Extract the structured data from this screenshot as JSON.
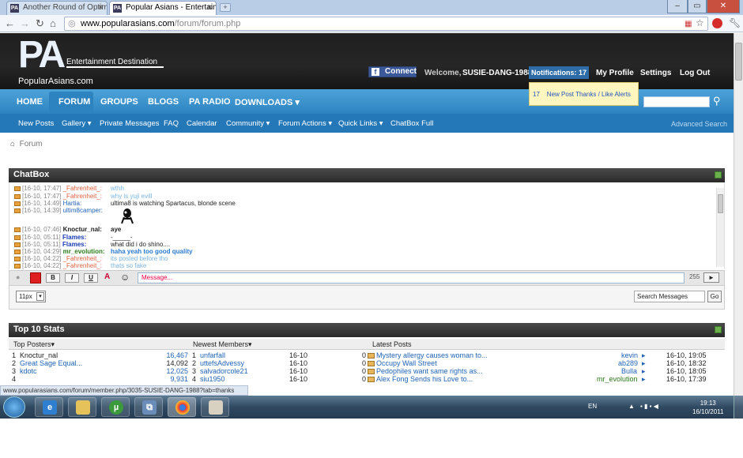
{
  "browser": {
    "tabs": [
      {
        "label": "Another Round of Optimiz"
      },
      {
        "label": "Popular Asians - Entertainm"
      }
    ],
    "url_host": "www.popularasians.com",
    "url_path": "/forum/forum.php",
    "status_url": "www.popularasians.com/forum/member.php/3035-SUSIE-DANG-1988?tab=thanks"
  },
  "header": {
    "logo_letters": "PA",
    "logo_tagline": "Entertainment Destination",
    "logo_site": "PopularAsians.com",
    "fb_connect": "Connect",
    "welcome": "Welcome,",
    "username": "SUSIE-DANG-1988",
    "notifications": "Notifications: 17",
    "my_profile": "My Profile",
    "settings": "Settings",
    "logout": "Log Out"
  },
  "notif_dropdown": {
    "count": "17",
    "label": "New Post Thanks / Like Alerts"
  },
  "mainnav": [
    "HOME",
    "FORUM",
    "GROUPS",
    "BLOGS",
    "PA RADIO",
    "DOWNLOADS ▾"
  ],
  "subnav": [
    "New Posts",
    "Gallery ▾",
    "Private Messages",
    "FAQ",
    "Calendar",
    "Community ▾",
    "Forum Actions ▾",
    "Quick Links ▾",
    "ChatBox Full"
  ],
  "advanced_search": "Advanced Search",
  "breadcrumb": "Forum",
  "chatbox": {
    "title": "ChatBox",
    "messages": [
      {
        "time": "[16-10, 17:47]",
        "user": "_Fahrenheit_:",
        "msg": "wthh",
        "ucolor": "#e06040",
        "mcolor": "#7ab4e0"
      },
      {
        "time": "[16-10, 17:47]",
        "user": "_Fahrenheit_:",
        "msg": "why is yuji evill",
        "ucolor": "#e06040",
        "mcolor": "#7ab4e0"
      },
      {
        "time": "[16-10, 14:49]",
        "user": "Hartia:",
        "msg": "ultima8 is watching Spartacus, blonde scene",
        "ucolor": "#2264b5",
        "mcolor": "#000"
      },
      {
        "time": "[16-10, 14:39]",
        "user": "ultim8camper:",
        "msg": "",
        "ucolor": "#2264b5",
        "mcolor": "#000"
      },
      {
        "time": "[16-10, 07:46]",
        "user": "Knoctur_nal:",
        "msg": "aye",
        "ucolor": "#000",
        "mcolor": "#000"
      },
      {
        "time": "[16-10, 05:11]",
        "user": "Flames:",
        "msg": "-_____-",
        "ucolor": "#1a3ab5",
        "mcolor": "#000"
      },
      {
        "time": "[16-10, 05:11]",
        "user": "Flames:",
        "msg": "what did i do shino....",
        "ucolor": "#1a3ab5",
        "mcolor": "#000"
      },
      {
        "time": "[16-10, 04:29]",
        "user": "mr_evolution:",
        "msg": "haha yeah too good quality",
        "ucolor": "#2a7a1a",
        "mcolor": "#2a7ad0"
      },
      {
        "time": "[16-10, 04:22]",
        "user": "_Fahrenheit_:",
        "msg": "its posted before tho",
        "ucolor": "#e06040",
        "mcolor": "#7ab4e0"
      },
      {
        "time": "[16-10, 04:22]",
        "user": "_Fahrenheit_:",
        "msg": "thats so fake",
        "ucolor": "#e06040",
        "mcolor": "#7ab4e0"
      }
    ],
    "placeholder": "Message...",
    "char_count": "255",
    "send": "►",
    "font_size": "11px",
    "search_messages": "Search Messages",
    "go": "Go",
    "fmt_bold": "B",
    "fmt_italic": "I",
    "fmt_underline": "U"
  },
  "stats": {
    "title": "Top 10 Stats",
    "col_posters": "Top Posters",
    "col_members": "Newest Members",
    "col_posts": "Latest Posts",
    "posters": [
      {
        "rank": "1",
        "name": "Knoctur_nal",
        "count": "16,467"
      },
      {
        "rank": "2",
        "name": "Great Sage Equal...",
        "count": "14,092"
      },
      {
        "rank": "3",
        "name": "kdotc",
        "count": "12,025"
      },
      {
        "rank": "4",
        "name": "",
        "count": "9,931"
      }
    ],
    "members": [
      {
        "rank": "1",
        "name": "unfarfall",
        "date": "16-10",
        "n": "0"
      },
      {
        "rank": "2",
        "name": "uttefsAdvessy",
        "date": "16-10",
        "n": "0"
      },
      {
        "rank": "3",
        "name": "salvadorcole21",
        "date": "16-10",
        "n": "0"
      },
      {
        "rank": "4",
        "name": "siu1950",
        "date": "16-10",
        "n": "0"
      }
    ],
    "posts": [
      {
        "title": "Mystery allergy causes woman to...",
        "user": "kevin",
        "time": "16-10, 19:05"
      },
      {
        "title": "Occupy Wall Street",
        "user": "ab289",
        "time": "16-10, 18:32"
      },
      {
        "title": "Pedophiles want same rights as...",
        "user": "Bulla",
        "time": "16-10, 18:05"
      },
      {
        "title": "Alex Fong Sends his Love to...",
        "user": "mr_evolution",
        "time": "16-10, 17:39"
      }
    ]
  },
  "taskbar": {
    "lang": "EN",
    "time": "19:13",
    "date": "16/10/2011"
  }
}
